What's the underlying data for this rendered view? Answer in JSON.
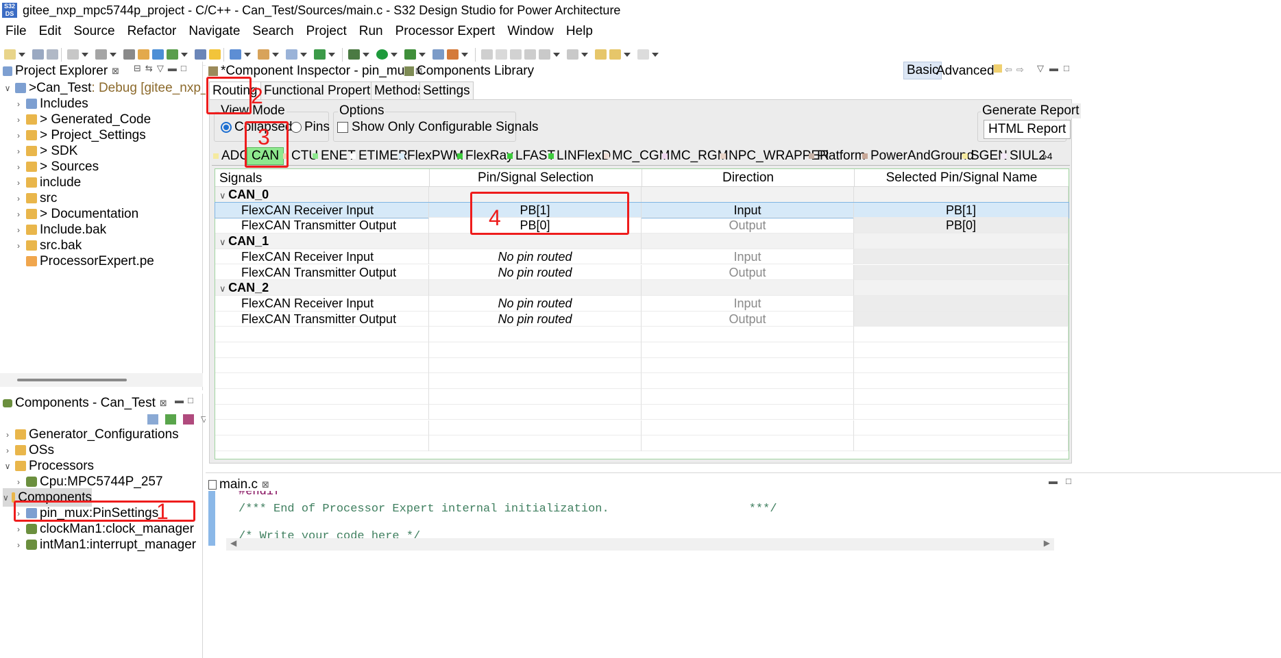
{
  "window": {
    "title": "gitee_nxp_mpc5744p_project - C/C++ - Can_Test/Sources/main.c - S32 Design Studio for Power Architecture",
    "icon_text": "S32\nDS"
  },
  "menu": [
    "File",
    "Edit",
    "Source",
    "Refactor",
    "Navigate",
    "Search",
    "Project",
    "Run",
    "Processor Expert",
    "Window",
    "Help"
  ],
  "project_explorer": {
    "title": "Project Explorer",
    "root": {
      "prefix": "> ",
      "name": "Can_Test",
      "suffix": ": Debug [gitee_nxp_mpc"
    },
    "items": [
      {
        "label": "Includes"
      },
      {
        "label": "> Generated_Code"
      },
      {
        "label": "> Project_Settings"
      },
      {
        "label": "> SDK"
      },
      {
        "label": "> Sources"
      },
      {
        "label": "include"
      },
      {
        "label": "src"
      },
      {
        "label": "> Documentation"
      },
      {
        "label": "Include.bak"
      },
      {
        "label": "src.bak"
      },
      {
        "label": "ProcessorExpert.pe"
      }
    ]
  },
  "components_view": {
    "title": "Components - Can_Test",
    "items": [
      {
        "label": "Generator_Configurations",
        "level": 0
      },
      {
        "label": "OSs",
        "level": 0
      },
      {
        "label": "Processors",
        "level": 0
      },
      {
        "label": "Cpu:MPC5744P_257",
        "level": 1
      },
      {
        "label": "Components",
        "level": 0
      },
      {
        "label": "pin_mux:PinSettings",
        "level": 1
      },
      {
        "label": "clockMan1:clock_manager",
        "level": 1
      },
      {
        "label": "intMan1:interrupt_manager",
        "level": 1
      }
    ]
  },
  "inspector": {
    "tab_title": "*Component Inspector - pin_mux",
    "library_tab": "Components Library",
    "basic": "Basic",
    "advanced": "Advanced",
    "subtabs": [
      "Routing",
      "Functional Properties",
      "Methods",
      "Settings"
    ],
    "view_mode_label": "View Mode",
    "view_mode_options": [
      "Collapsed",
      "Pins"
    ],
    "options_label": "Options",
    "option_checkbox": "Show Only Configurable Signals",
    "generate_report_label": "Generate Report",
    "html_report_button": "HTML Report",
    "groups": [
      "ADC",
      "CAN",
      "CTU",
      "ENET",
      "ETIMER",
      "FlexPWM",
      "FlexRay",
      "LFAST",
      "LINFlexD",
      "MC_CGM",
      "MC_RGM",
      "NPC_WRAPPER",
      "Platform",
      "PowerAndGround",
      "SGEN",
      "SIUL2"
    ],
    "more_groups": "»4",
    "columns": [
      "Signals",
      "Pin/Signal Selection",
      "Direction",
      "Selected Pin/Signal Name"
    ],
    "rows": [
      {
        "type": "group",
        "signal": "CAN_0"
      },
      {
        "type": "signal",
        "signal": "FlexCAN Receiver Input",
        "selection": "PB[1]",
        "direction": "Input",
        "name": "PB[1]",
        "selected": true
      },
      {
        "type": "signal",
        "signal": "FlexCAN Transmitter Output",
        "selection": "PB[0]",
        "direction": "Output",
        "name": "PB[0]"
      },
      {
        "type": "group",
        "signal": "CAN_1"
      },
      {
        "type": "signal",
        "signal": "FlexCAN Receiver Input",
        "selection": "No pin routed",
        "direction": "Input",
        "name": ""
      },
      {
        "type": "signal",
        "signal": "FlexCAN Transmitter Output",
        "selection": "No pin routed",
        "direction": "Output",
        "name": ""
      },
      {
        "type": "group",
        "signal": "CAN_2"
      },
      {
        "type": "signal",
        "signal": "FlexCAN Receiver Input",
        "selection": "No pin routed",
        "direction": "Input",
        "name": ""
      },
      {
        "type": "signal",
        "signal": "FlexCAN Transmitter Output",
        "selection": "No pin routed",
        "direction": "Output",
        "name": ""
      }
    ]
  },
  "editor": {
    "tab": "main.c",
    "lines": [
      "#endif",
      "/*** End of Processor Expert internal initialization.                    ***/",
      "",
      "/* Write your code here */"
    ]
  },
  "annotations": [
    "1",
    "2",
    "3",
    "4"
  ],
  "colors": {
    "highlight_green": "#8ee88e",
    "annotation_red": "#ee1c1c",
    "selected_row": "#d6e9f8"
  }
}
